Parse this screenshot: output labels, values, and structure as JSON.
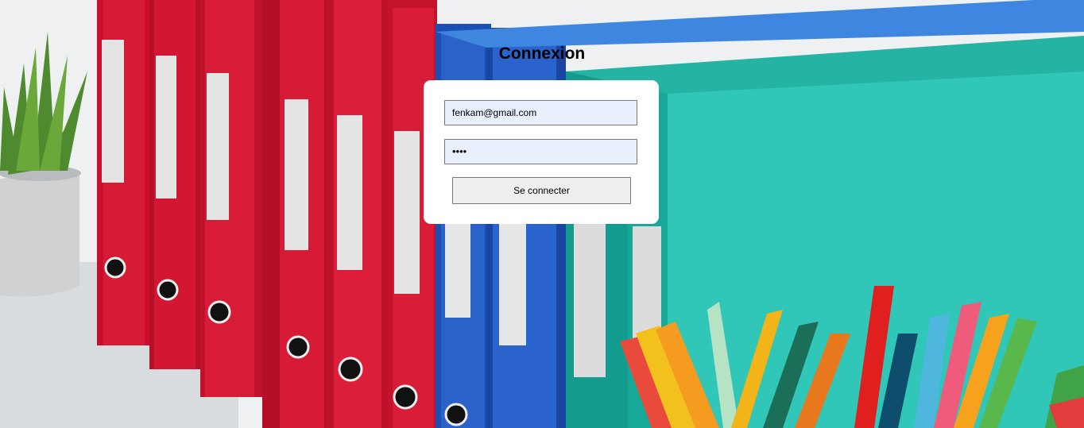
{
  "page": {
    "title": "Connexion"
  },
  "login_form": {
    "email_value": "fenkam@gmail.com",
    "password_masked": "••••",
    "submit_label": "Se connecter"
  },
  "background": {
    "description_icon": "office-binders-photo-icon"
  }
}
